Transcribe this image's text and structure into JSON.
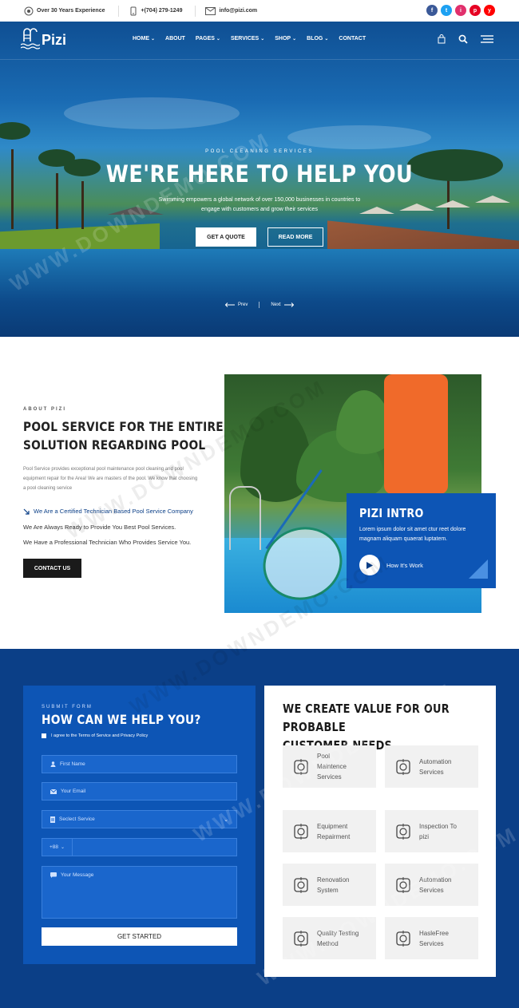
{
  "topbar": {
    "experience": "Over 30 Years Experience",
    "phone": "+(704) 279-1249",
    "email": "info@pizi.com",
    "social": [
      {
        "name": "facebook",
        "glyph": "f",
        "color": "#3b5998"
      },
      {
        "name": "twitter",
        "glyph": "t",
        "color": "#1da1f2"
      },
      {
        "name": "instagram",
        "glyph": "i",
        "color": "#e1306c"
      },
      {
        "name": "pinterest",
        "glyph": "p",
        "color": "#e60023"
      },
      {
        "name": "youtube",
        "glyph": "y",
        "color": "#ff0000"
      }
    ]
  },
  "nav": {
    "logo": "Pizi",
    "items": [
      "HOME",
      "ABOUT",
      "PAGES",
      "SERVICES",
      "SHOP",
      "BLOG",
      "CONTACT"
    ]
  },
  "hero": {
    "kicker": "POOL CLEANING SERVICES",
    "title": "WE'RE HERE TO HELP YOU",
    "subtitle": "Swimming empowers a global network of over 150,000 businesses in countries to engage with customers and grow their services",
    "btn_quote": "GET A QUOTE",
    "btn_more": "READ MORE",
    "prev": "Prev",
    "next": "Next"
  },
  "about": {
    "kicker": "ABOUT PIZI",
    "title_line1": "POOL SERVICE FOR THE ENTIRE",
    "title_line2": "SOLUTION REGARDING POOL",
    "para": "Pool Service provides exceptional pool maintenance pool cleaning and pool equipment repair for the Area! We are masters of the pool. We know that choosing a pool cleaning service",
    "points": [
      "We Are a Certified Technician Based Pool Service Company",
      "We Are Always Ready to Provide You Best Pool Services.",
      "We Have a Professional Technician Who Provides Service You."
    ],
    "contact_btn": "CONTACT US"
  },
  "intro": {
    "title": "PIZI INTRO",
    "text": "Lorem ipsum dolor sit amet ctur reet dolore magnam aliquam quaerat luptatem.",
    "play_label": "How It's Work"
  },
  "form": {
    "kicker": "SUBMIT FORM",
    "title": "HOW CAN WE HELP YOU?",
    "agree": "I agree to the Terms of Service and Privacy Policy",
    "first_name": "First Name",
    "email": "Your Email",
    "service": "Seclect Service",
    "phone_code": "+88",
    "message": "Your Message",
    "submit": "GET STARTED"
  },
  "value": {
    "title_line1": "WE CREATE VALUE FOR OUR PROBABLE",
    "title_line2": "CUSTOMER NEEDS",
    "cards": [
      {
        "l1": "Pool",
        "l2": "Maintence",
        "l3": "Services",
        "icon": "pool-maintenance-icon"
      },
      {
        "l1": "Automation",
        "l2": "Services",
        "l3": "",
        "icon": "automation-icon"
      },
      {
        "l1": "Equipment",
        "l2": "Repairment",
        "l3": "",
        "icon": "helmet-icon"
      },
      {
        "l1": "Inspection To",
        "l2": "pizi",
        "l3": "",
        "icon": "inspection-icon"
      },
      {
        "l1": "Renovation",
        "l2": "System",
        "l3": "",
        "icon": "renovation-icon"
      },
      {
        "l1": "Automation",
        "l2": "Services",
        "l3": "",
        "icon": "automation-icon"
      },
      {
        "l1": "Quality Testing",
        "l2": "Method",
        "l3": "",
        "icon": "quality-badge-icon"
      },
      {
        "l1": "HasleFree",
        "l2": "Services",
        "l3": "",
        "icon": "hasslefree-icon"
      }
    ]
  },
  "watermark": "WWW.DOWNDEMO.COM",
  "colors": {
    "primary": "#0d55b5",
    "dark_blue": "#0b3f87",
    "accent": "#4a90e2"
  }
}
